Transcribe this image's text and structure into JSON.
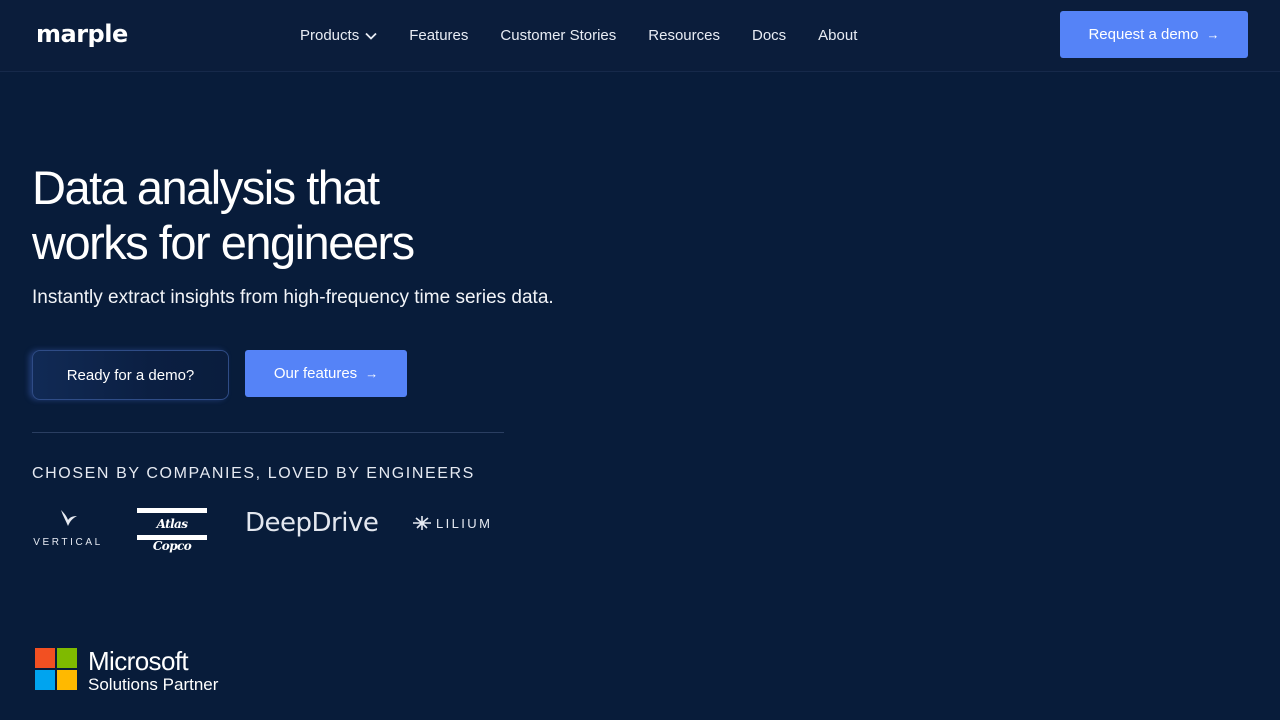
{
  "header": {
    "logo": "marple",
    "nav": [
      {
        "label": "Products",
        "has_dropdown": true
      },
      {
        "label": "Features"
      },
      {
        "label": "Customer Stories"
      },
      {
        "label": "Resources"
      },
      {
        "label": "Docs"
      },
      {
        "label": "About"
      }
    ],
    "cta_label": "Request a demo",
    "cta_icon": "arrow-right-icon"
  },
  "hero": {
    "title_line1": "Data analysis that",
    "title_line2": "works for engineers",
    "subtitle": "Instantly extract insights from high-frequency time series data.",
    "primary_button": "Ready for a demo?",
    "secondary_button": "Our features",
    "secondary_icon": "arrow-right-icon"
  },
  "customers": {
    "heading": "CHOSEN BY COMPANIES, LOVED BY ENGINEERS",
    "logos": [
      {
        "name": "VERTICAL"
      },
      {
        "name": "Atlas Copco"
      },
      {
        "name": "DeepDrive"
      },
      {
        "name": "LILIUM"
      }
    ]
  },
  "partner": {
    "title": "Microsoft",
    "subtitle": "Solutions Partner",
    "colors": [
      "#f25022",
      "#7fba00",
      "#00a4ef",
      "#ffb900"
    ]
  },
  "colors": {
    "background": "#081c3a",
    "accent": "#5583f7"
  }
}
